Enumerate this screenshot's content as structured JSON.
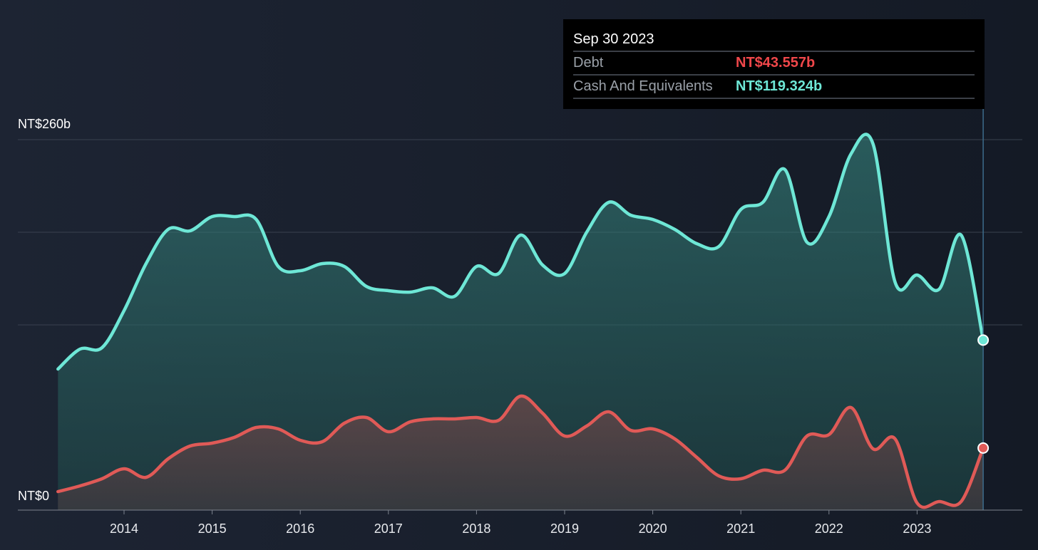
{
  "chart_data": {
    "type": "area",
    "y_unit_labels": {
      "top": "NT$260b",
      "bottom": "NT$0"
    },
    "ylim": [
      0,
      260
    ],
    "grid": true,
    "x_ticks": [
      "2014",
      "2015",
      "2016",
      "2017",
      "2018",
      "2019",
      "2020",
      "2021",
      "2022",
      "2023"
    ],
    "series": [
      {
        "name": "Cash And Equivalents",
        "color": "#6ee7d6",
        "points": [
          [
            2013.25,
            99
          ],
          [
            2013.5,
            113
          ],
          [
            2013.75,
            114
          ],
          [
            2014.0,
            140
          ],
          [
            2014.25,
            173
          ],
          [
            2014.5,
            197
          ],
          [
            2014.75,
            196
          ],
          [
            2015.0,
            206
          ],
          [
            2015.25,
            206
          ],
          [
            2015.5,
            204
          ],
          [
            2015.75,
            171
          ],
          [
            2016.0,
            168
          ],
          [
            2016.25,
            173
          ],
          [
            2016.5,
            171
          ],
          [
            2016.75,
            157
          ],
          [
            2017.0,
            154
          ],
          [
            2017.25,
            153
          ],
          [
            2017.5,
            156
          ],
          [
            2017.75,
            150
          ],
          [
            2018.0,
            171
          ],
          [
            2018.25,
            166
          ],
          [
            2018.5,
            193
          ],
          [
            2018.75,
            172
          ],
          [
            2019.0,
            166
          ],
          [
            2019.25,
            195
          ],
          [
            2019.5,
            216
          ],
          [
            2019.75,
            207
          ],
          [
            2020.0,
            204
          ],
          [
            2020.25,
            197
          ],
          [
            2020.5,
            187
          ],
          [
            2020.75,
            185
          ],
          [
            2021.0,
            211
          ],
          [
            2021.25,
            216
          ],
          [
            2021.5,
            239
          ],
          [
            2021.75,
            188
          ],
          [
            2022.0,
            206
          ],
          [
            2022.25,
            250
          ],
          [
            2022.5,
            257
          ],
          [
            2022.75,
            160
          ],
          [
            2023.0,
            165
          ],
          [
            2023.25,
            155
          ],
          [
            2023.5,
            193
          ],
          [
            2023.75,
            119.324
          ]
        ]
      },
      {
        "name": "Debt",
        "color": "#e05a57",
        "points": [
          [
            2013.25,
            13
          ],
          [
            2013.5,
            17
          ],
          [
            2013.75,
            22
          ],
          [
            2014.0,
            29
          ],
          [
            2014.25,
            23
          ],
          [
            2014.5,
            36
          ],
          [
            2014.75,
            45
          ],
          [
            2015.0,
            47
          ],
          [
            2015.25,
            51
          ],
          [
            2015.5,
            58
          ],
          [
            2015.75,
            57
          ],
          [
            2016.0,
            49
          ],
          [
            2016.25,
            48
          ],
          [
            2016.5,
            61
          ],
          [
            2016.75,
            65
          ],
          [
            2017.0,
            55
          ],
          [
            2017.25,
            62
          ],
          [
            2017.5,
            64
          ],
          [
            2017.75,
            64
          ],
          [
            2018.0,
            65
          ],
          [
            2018.25,
            63
          ],
          [
            2018.5,
            80
          ],
          [
            2018.75,
            68
          ],
          [
            2019.0,
            52
          ],
          [
            2019.25,
            59
          ],
          [
            2019.5,
            69
          ],
          [
            2019.75,
            56
          ],
          [
            2020.0,
            57
          ],
          [
            2020.25,
            50
          ],
          [
            2020.5,
            37
          ],
          [
            2020.75,
            24
          ],
          [
            2021.0,
            22
          ],
          [
            2021.25,
            28
          ],
          [
            2021.5,
            28
          ],
          [
            2021.75,
            52
          ],
          [
            2022.0,
            53
          ],
          [
            2022.25,
            72
          ],
          [
            2022.5,
            43
          ],
          [
            2022.75,
            50
          ],
          [
            2023.0,
            5
          ],
          [
            2023.25,
            6
          ],
          [
            2023.5,
            6
          ],
          [
            2023.75,
            43.557
          ]
        ]
      }
    ]
  },
  "tooltip": {
    "date": "Sep 30 2023",
    "rows": [
      {
        "name": "Debt",
        "value": "NT$43.557b",
        "color": "#f0474a"
      },
      {
        "name": "Cash And Equivalents",
        "value": "NT$119.324b",
        "color": "#6ee7d6"
      }
    ]
  }
}
